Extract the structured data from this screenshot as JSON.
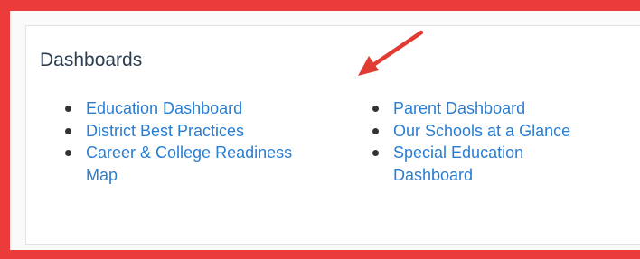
{
  "section": {
    "title": "Dashboards"
  },
  "dashboards": {
    "left": [
      {
        "label": "Education Dashboard"
      },
      {
        "label": "District Best Practices"
      },
      {
        "label": "Career & College Readiness Map"
      }
    ],
    "right": [
      {
        "label": "Parent Dashboard"
      },
      {
        "label": "Our Schools at a Glance"
      },
      {
        "label": "Special Education Dashboard"
      }
    ]
  },
  "colors": {
    "highlight_border": "#ec3b3b",
    "arrow": "#e23b33",
    "link": "#2a7ed2",
    "heading": "#2d3e4f"
  },
  "annotation": {
    "icon": "red-arrow-icon"
  }
}
